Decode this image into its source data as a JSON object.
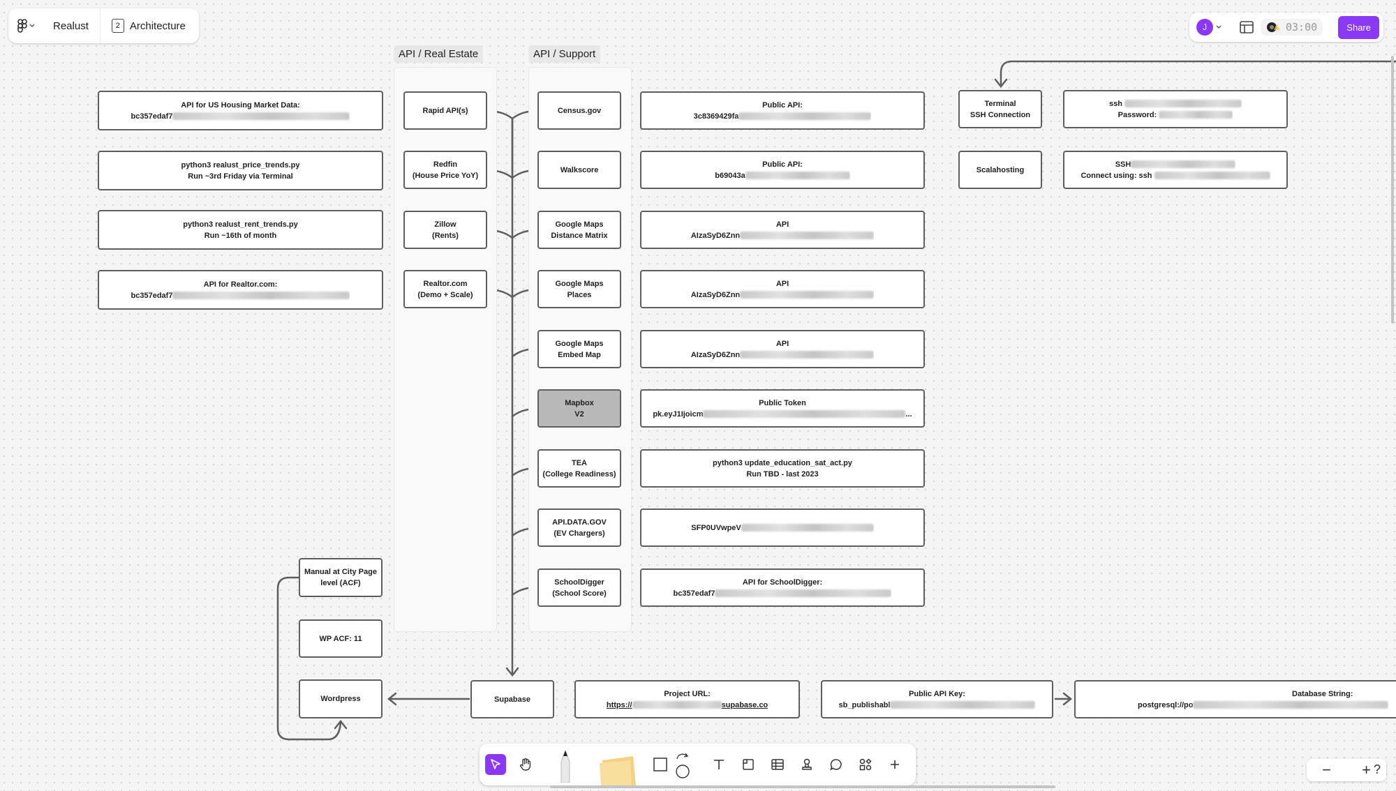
{
  "toolbar": {
    "file_name": "Realust",
    "page_number": "2",
    "page_name": "Architecture"
  },
  "topright": {
    "avatar_initial": "J",
    "timer": "03:00",
    "share_label": "Share"
  },
  "sections": {
    "real_estate": "API / Real Estate",
    "support": "API / Support"
  },
  "left_notes": [
    {
      "l1": "API for US Housing Market Data:",
      "l2": "bc357edaf7"
    },
    {
      "l1": "python3 realust_price_trends.py",
      "l2": "Run ~3rd Friday via Terminal"
    },
    {
      "l1": "python3 realust_rent_trends.py",
      "l2": "Run ~16th of month"
    },
    {
      "l1": "API for Realtor.com:",
      "l2": "bc357edaf7"
    }
  ],
  "real_estate": [
    {
      "l1": "Rapid API(s)",
      "l2": ""
    },
    {
      "l1": "Redfin",
      "l2": "(House Price YoY)"
    },
    {
      "l1": "Zillow",
      "l2": "(Rents)"
    },
    {
      "l1": "Realtor.com",
      "l2": "(Demo + Scale)"
    }
  ],
  "support": [
    {
      "l1": "Census.gov",
      "l2": ""
    },
    {
      "l1": "Walkscore",
      "l2": ""
    },
    {
      "l1": "Google Maps",
      "l2": "Distance Matrix"
    },
    {
      "l1": "Google Maps",
      "l2": "Places"
    },
    {
      "l1": "Google Maps",
      "l2": "Embed Map"
    },
    {
      "l1": "Mapbox",
      "l2": "V2"
    },
    {
      "l1": "TEA",
      "l2": "(College Readiness)"
    },
    {
      "l1": "API.DATA.GOV",
      "l2": "(EV Chargers)"
    },
    {
      "l1": "SchoolDigger",
      "l2": "(School Score)"
    }
  ],
  "support_keys": [
    {
      "l1": "Public API:",
      "l2": "3c8369429fa"
    },
    {
      "l1": "Public API:",
      "l2": "b69043a"
    },
    {
      "l1": "API",
      "l2": "AIzaSyD6Znn"
    },
    {
      "l1": "API",
      "l2": "AIzaSyD6Znn"
    },
    {
      "l1": "API",
      "l2": "AIzaSyD6Znn"
    },
    {
      "l1": "Public Token",
      "l2": "pk.eyJ1Ijoicm",
      "l2_end": "..."
    },
    {
      "l1": "python3 update_education_sat_act.py",
      "l2": "Run TBD - last 2023"
    },
    {
      "l1": "SFP0UVwpeV",
      "l2": ""
    },
    {
      "l1": "API for SchoolDigger:",
      "l2": "bc357edaf7"
    }
  ],
  "hosting": {
    "terminal_l1": "Terminal",
    "terminal_l2": "SSH Connection",
    "ssh_l1": "ssh",
    "ssh_l2": "Password:",
    "scalahosting": "Scalahosting",
    "ssh2_l1": "SSH",
    "ssh2_l2": "Connect using: ssh"
  },
  "wp": {
    "manual_l1": "Manual at City Page",
    "manual_l2": "level (ACF)",
    "acf": "WP ACF: 11",
    "wordpress": "Wordpress"
  },
  "bottom": {
    "supabase": "Supabase",
    "project_l1": "Project URL:",
    "project_pre": "https://",
    "project_post": "supabase.co",
    "pubkey_l1": "Public API Key:",
    "pubkey_l2": "sb_publishabl",
    "db_l1": "Database String:",
    "db_l2": "postgresql://po"
  },
  "colors": {
    "accent": "#8a38f5",
    "node_border": "#5e5e5e",
    "connector": "#5e5e5e",
    "mapbox_fill": "#b9b9b9"
  },
  "icons": [
    "figma-menu-icon",
    "chevron-down-icon",
    "page-icon",
    "layout-icon",
    "timer-icon",
    "select-icon",
    "hand-icon",
    "pen-icon",
    "sticky-note-icon",
    "shape-icon",
    "connector-icon",
    "text-icon",
    "section-icon",
    "table-icon",
    "stamp-icon",
    "comment-icon",
    "widgets-icon",
    "plus-icon",
    "zoom-out-icon",
    "zoom-in-icon",
    "help-icon"
  ]
}
